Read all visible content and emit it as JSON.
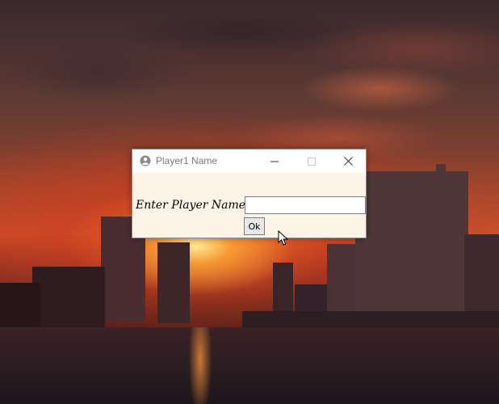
{
  "desktop": {
    "wallpaper": "sunset-over-water"
  },
  "window": {
    "title": "Player1 Name",
    "icon": "user-circle-icon",
    "controls": {
      "minimize_icon": "minimize-icon",
      "maximize_icon": "maximize-icon",
      "close_icon": "close-icon"
    }
  },
  "form": {
    "label": "Enter Player Name",
    "name_value": "",
    "ok_label": "Ok"
  },
  "colors": {
    "dialog_bg": "#fdf3e6",
    "titlebar_bg": "#ffffff",
    "title_text": "#7a7a7a"
  }
}
